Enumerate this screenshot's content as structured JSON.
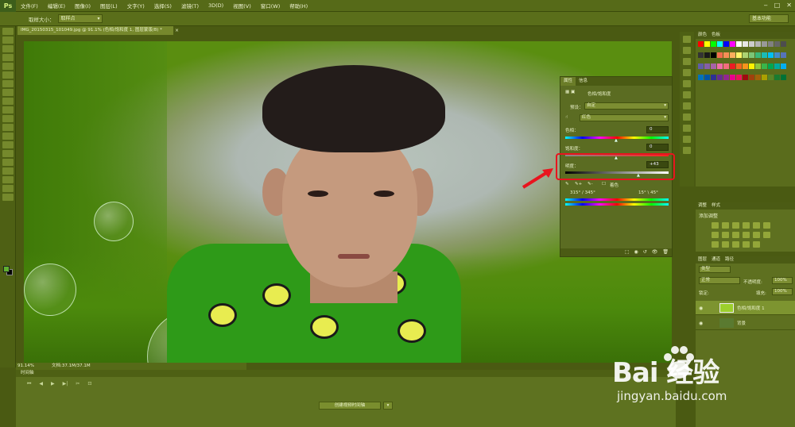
{
  "app": {
    "logo": "Ps",
    "menus": [
      "文件(F)",
      "编辑(E)",
      "图像(I)",
      "图层(L)",
      "文字(Y)",
      "选择(S)",
      "滤镜(T)",
      "3D(D)",
      "视图(V)",
      "窗口(W)",
      "帮助(H)"
    ],
    "window_controls": [
      "‒",
      "□",
      "✕"
    ]
  },
  "options_bar": {
    "sample_size_label": "取样大小：",
    "sample_size_value": "取样点",
    "workspace": "基本功能"
  },
  "document": {
    "tab_title": "IMG_20150315_101049.jpg @ 91.1% (色相/饱和度 1, 图层蒙版/8) *",
    "tab_close": "×",
    "zoom": "91.14%",
    "doc_size": "文档:37.1M/37.1M"
  },
  "timeline": {
    "title": "时间轴",
    "create_button": "创建视频时间轴",
    "controls": [
      "⏮",
      "◀",
      "▶",
      "▶|",
      "✂",
      "⊡"
    ]
  },
  "properties": {
    "tabs": [
      "属性",
      "信息"
    ],
    "panel_title": "色相/饱和度",
    "preset_label": "预设：",
    "preset_value": "自定",
    "channel_value": "红色",
    "hue_label": "色相：",
    "hue_value": "0",
    "saturation_label": "饱和度：",
    "saturation_value": "0",
    "lightness_label": "明度：",
    "lightness_value": "+43",
    "lightness_level": 0.715,
    "colorize_label": "着色",
    "range_left": "315° / 345°",
    "range_right": "15° \\ 45°"
  },
  "swatches": {
    "tabs": [
      "颜色",
      "色板"
    ],
    "colors": [
      "#ff0000",
      "#ffff00",
      "#00ff00",
      "#00ffff",
      "#0000ff",
      "#ff00ff",
      "#ffffff",
      "#e6e6e6",
      "#cccccc",
      "#b3b3b3",
      "#999999",
      "#808080",
      "#666666",
      "#4d4d4d",
      "#333333",
      "#1a1a1a",
      "#000000",
      "#f26c4f",
      "#f68e56",
      "#fbaf5d",
      "#fff568",
      "#acd372",
      "#7cc576",
      "#3bb878",
      "#1abbb4",
      "#00bff3",
      "#438ccb",
      "#5574b9",
      "#605ca8",
      "#855fa8",
      "#a763a8",
      "#f06ea9",
      "#f26d7d",
      "#ed1c24",
      "#f26522",
      "#f7941d",
      "#fff200",
      "#8dc63f",
      "#39b54a",
      "#00a651",
      "#00a99d",
      "#00aeef",
      "#0072bc",
      "#0054a6",
      "#2e3192",
      "#662d91",
      "#92278f",
      "#ec008c",
      "#ed145b",
      "#9e0b0f",
      "#a0410d",
      "#a36209",
      "#aba000",
      "#598527",
      "#1a7b30",
      "#007236"
    ]
  },
  "adjustments": {
    "tabs": [
      "调整",
      "样式"
    ],
    "label": "添加调整"
  },
  "layers": {
    "tabs": [
      "图层",
      "通道",
      "路径"
    ],
    "kind_label": "类型",
    "blend_mode": "正常",
    "opacity_label": "不透明度:",
    "opacity_value": "100%",
    "lock_label": "锁定:",
    "fill_label": "填充:",
    "fill_value": "100%",
    "items": [
      {
        "name": "色相/饱和度 1",
        "selected": true
      },
      {
        "name": "背景",
        "selected": false
      }
    ]
  },
  "watermark": {
    "brand": "Bai  经验",
    "url": "jingyan.baidu.com"
  },
  "colors": {
    "highlight": "#e8141e",
    "ui_base": "#566a18"
  }
}
